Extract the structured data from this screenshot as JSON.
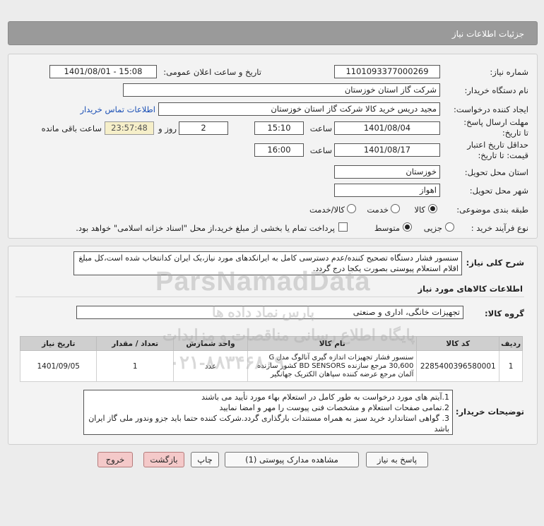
{
  "header": {
    "title": "جزئیات اطلاعات نیاز"
  },
  "form": {
    "need_number_label": "شماره نیاز:",
    "need_number": "1101093377000269",
    "announce_label": "تاریخ و ساعت اعلان عمومی:",
    "announce_value": "1401/08/01 - 15:08",
    "buyer_org_label": "نام دستگاه خریدار:",
    "buyer_org": "شرکت گاز استان خوزستان",
    "creator_label": "ایجاد کننده درخواست:",
    "creator": "مجید دریس خرید کالا شرکت گاز استان خوزستان",
    "contact_link": "اطلاعات تماس خریدار",
    "deadline_label": "مهلت ارسال پاسخ: تا تاریخ:",
    "deadline_date": "1401/08/04",
    "time_label": "ساعت",
    "deadline_time": "15:10",
    "days": "2",
    "days_label": "روز و",
    "remaining_time": "23:57:48",
    "remaining_label": "ساعت باقی مانده",
    "validity_label": "حداقل تاریخ اعتبار قیمت: تا تاریخ:",
    "validity_date": "1401/08/17",
    "validity_time": "16:00",
    "province_label": "استان محل تحویل:",
    "province": "خوزستان",
    "city_label": "شهر محل تحویل:",
    "city": "اهواز",
    "category_label": "طبقه بندی موضوعی:",
    "category_options": [
      "کالا",
      "خدمت",
      "کالا/خدمت"
    ],
    "process_label": "نوع فرآیند خرید :",
    "process_options": [
      "جزیی",
      "متوسط"
    ],
    "payment_note": "پرداخت تمام یا بخشی از مبلغ خرید،از محل \"اسناد خزانه اسلامی\" خواهد بود."
  },
  "summary": {
    "label": "شرح کلی نیاز:",
    "text": "سنسور فشار دستگاه تصحیح کننده/عدم دسترسی کامل به ایرانکدهای مورد نیاز،یک ایران کدانتخاب شده است،کل مبلغ اقلام استعلام پیوستی بصورت یکجا درج گردد."
  },
  "goods": {
    "section_title": "اطلاعات کالاهای مورد نیاز",
    "group_label": "گروه کالا:",
    "group_value": "تجهیزات خانگی، اداری و صنعتی",
    "columns": [
      "ردیف",
      "کد کالا",
      "نام کالا",
      "واحد شمارش",
      "تعداد / مقدار",
      "تاریخ نیاز"
    ],
    "rows": [
      {
        "row": "1",
        "code": "2285400396580001",
        "name": "سنسور فشار تجهیزات اندازه گیری آنالوگ مدل G 30,600 مرجع سازنده BD SENSORS کشور سازنده آلمان مرجع عرضه کننده سپاهان الکتریک جهانگیر",
        "unit": "عدد",
        "qty": "1",
        "date": "1401/09/05"
      }
    ]
  },
  "notes": {
    "label": "توضیحات خریدار:",
    "lines": [
      "1.آیتم های مورد درخواست به طور کامل در استعلام بهاء مورد تأیید می باشند",
      "2.تمامی صفحات استعلام و مشخصات فنی پیوست را مهر و امضا نمایید",
      "3. گواهی استاندارد خرید سبز به همراه مستندات بارگذاری گردد.شرکت کننده حتما باید جزو وندور ملی گاز ایران باشد"
    ]
  },
  "buttons": {
    "reply": "پاسخ به نیاز",
    "docs": "مشاهده مدارک پیوستی (1)",
    "print": "چاپ",
    "back": "بازگشت",
    "exit": "خروج"
  },
  "watermark": {
    "brand": "ParsNamadData",
    "line1": "پایگاه اطلاع رسانی مناقصات و مزایدات",
    "line2": "پارس نماد داده ها",
    "phone": "۰۲۱-۸۸۳۴۶۸۰۹"
  }
}
